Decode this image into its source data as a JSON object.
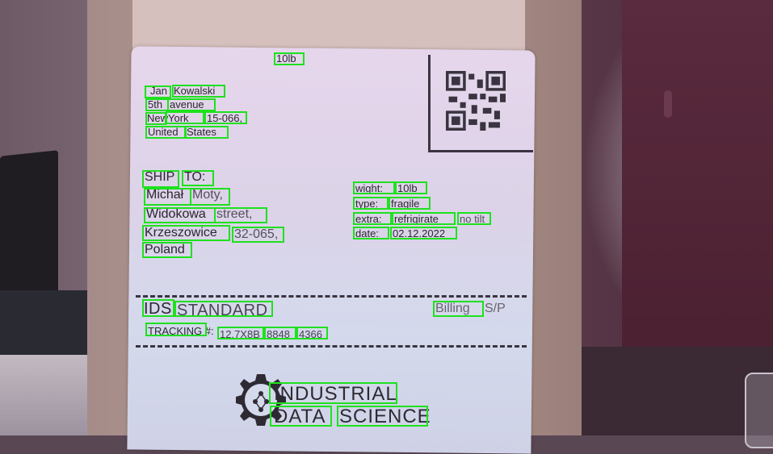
{
  "label": {
    "top_weight": "10lb",
    "sender": {
      "first_name": "Jan",
      "last_name": "Kowalski",
      "street_num": "5th",
      "street": "avenue",
      "city_a": "New",
      "city_b": "York",
      "zip": "15-066,",
      "country_a": "United",
      "country_b": "States"
    },
    "ship_to": {
      "heading_a": "SHIP",
      "heading_b": "TO:",
      "first_name": "Michał",
      "last_name": "Moty,",
      "street_a": "Widokowa",
      "street_b": "street,",
      "city": "Krzeszowice",
      "zip": "32-065,",
      "country": "Poland"
    },
    "details": {
      "weight_label": "wight:",
      "weight_value": "10lb",
      "type_label": "type:",
      "type_value": "fragile",
      "extra_label": "extra:",
      "extra_value": "refrigirate",
      "extra_note": "no tilt",
      "date_label": "date:",
      "date_value": "02.12.2022"
    },
    "service": {
      "carrier": "IDS",
      "level": "STANDARD",
      "billing": "Billing",
      "billing_suffix": "S/P"
    },
    "tracking": {
      "label": "TRACKING #:",
      "number_a": "12.7X8B",
      "number_b": "8848",
      "number_c": "4366"
    },
    "logo": {
      "line1": "INDUSTRIAL",
      "line2_a": "DATA",
      "line2_b": "SCIENCE"
    }
  },
  "colors": {
    "detection_box": "#1ee11e",
    "label_ink": "#2b2630"
  }
}
